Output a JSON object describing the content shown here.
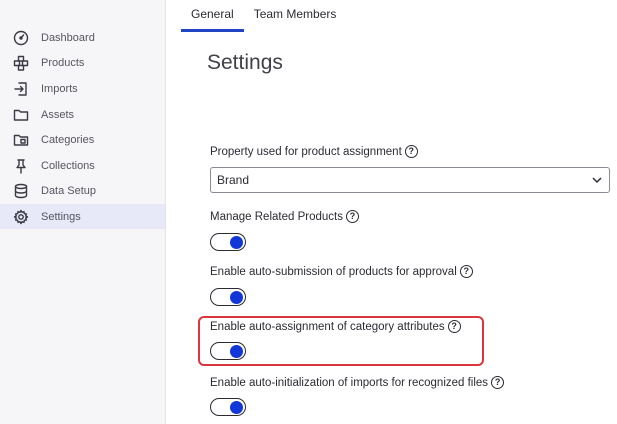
{
  "sidebar": {
    "items": [
      {
        "label": "Dashboard",
        "icon": "dashboard-icon"
      },
      {
        "label": "Products",
        "icon": "products-icon"
      },
      {
        "label": "Imports",
        "icon": "imports-icon"
      },
      {
        "label": "Assets",
        "icon": "folder-icon"
      },
      {
        "label": "Categories",
        "icon": "categories-icon"
      },
      {
        "label": "Collections",
        "icon": "pin-icon"
      },
      {
        "label": "Data Setup",
        "icon": "database-icon"
      },
      {
        "label": "Settings",
        "icon": "gear-icon",
        "active": true
      }
    ]
  },
  "tabs": [
    {
      "label": "General",
      "active": true
    },
    {
      "label": "Team Members",
      "active": false
    }
  ],
  "page": {
    "title": "Settings"
  },
  "settings": {
    "property_label": "Property used for product assignment",
    "property_value": "Brand",
    "related_label": "Manage Related Products",
    "related_on": true,
    "autosubmit_label": "Enable auto-submission of products for approval",
    "autosubmit_on": true,
    "autoassign_label": "Enable auto-assignment of category attributes",
    "autoassign_on": true,
    "autoinit_label": "Enable auto-initialization of imports for recognized files",
    "autoinit_on": true
  },
  "help_glyph": "?",
  "colors": {
    "accent": "#1f45c4",
    "toggle_knob": "#1237d9",
    "highlight": "#d9363e",
    "active_nav_bg": "#e7e8f8"
  }
}
